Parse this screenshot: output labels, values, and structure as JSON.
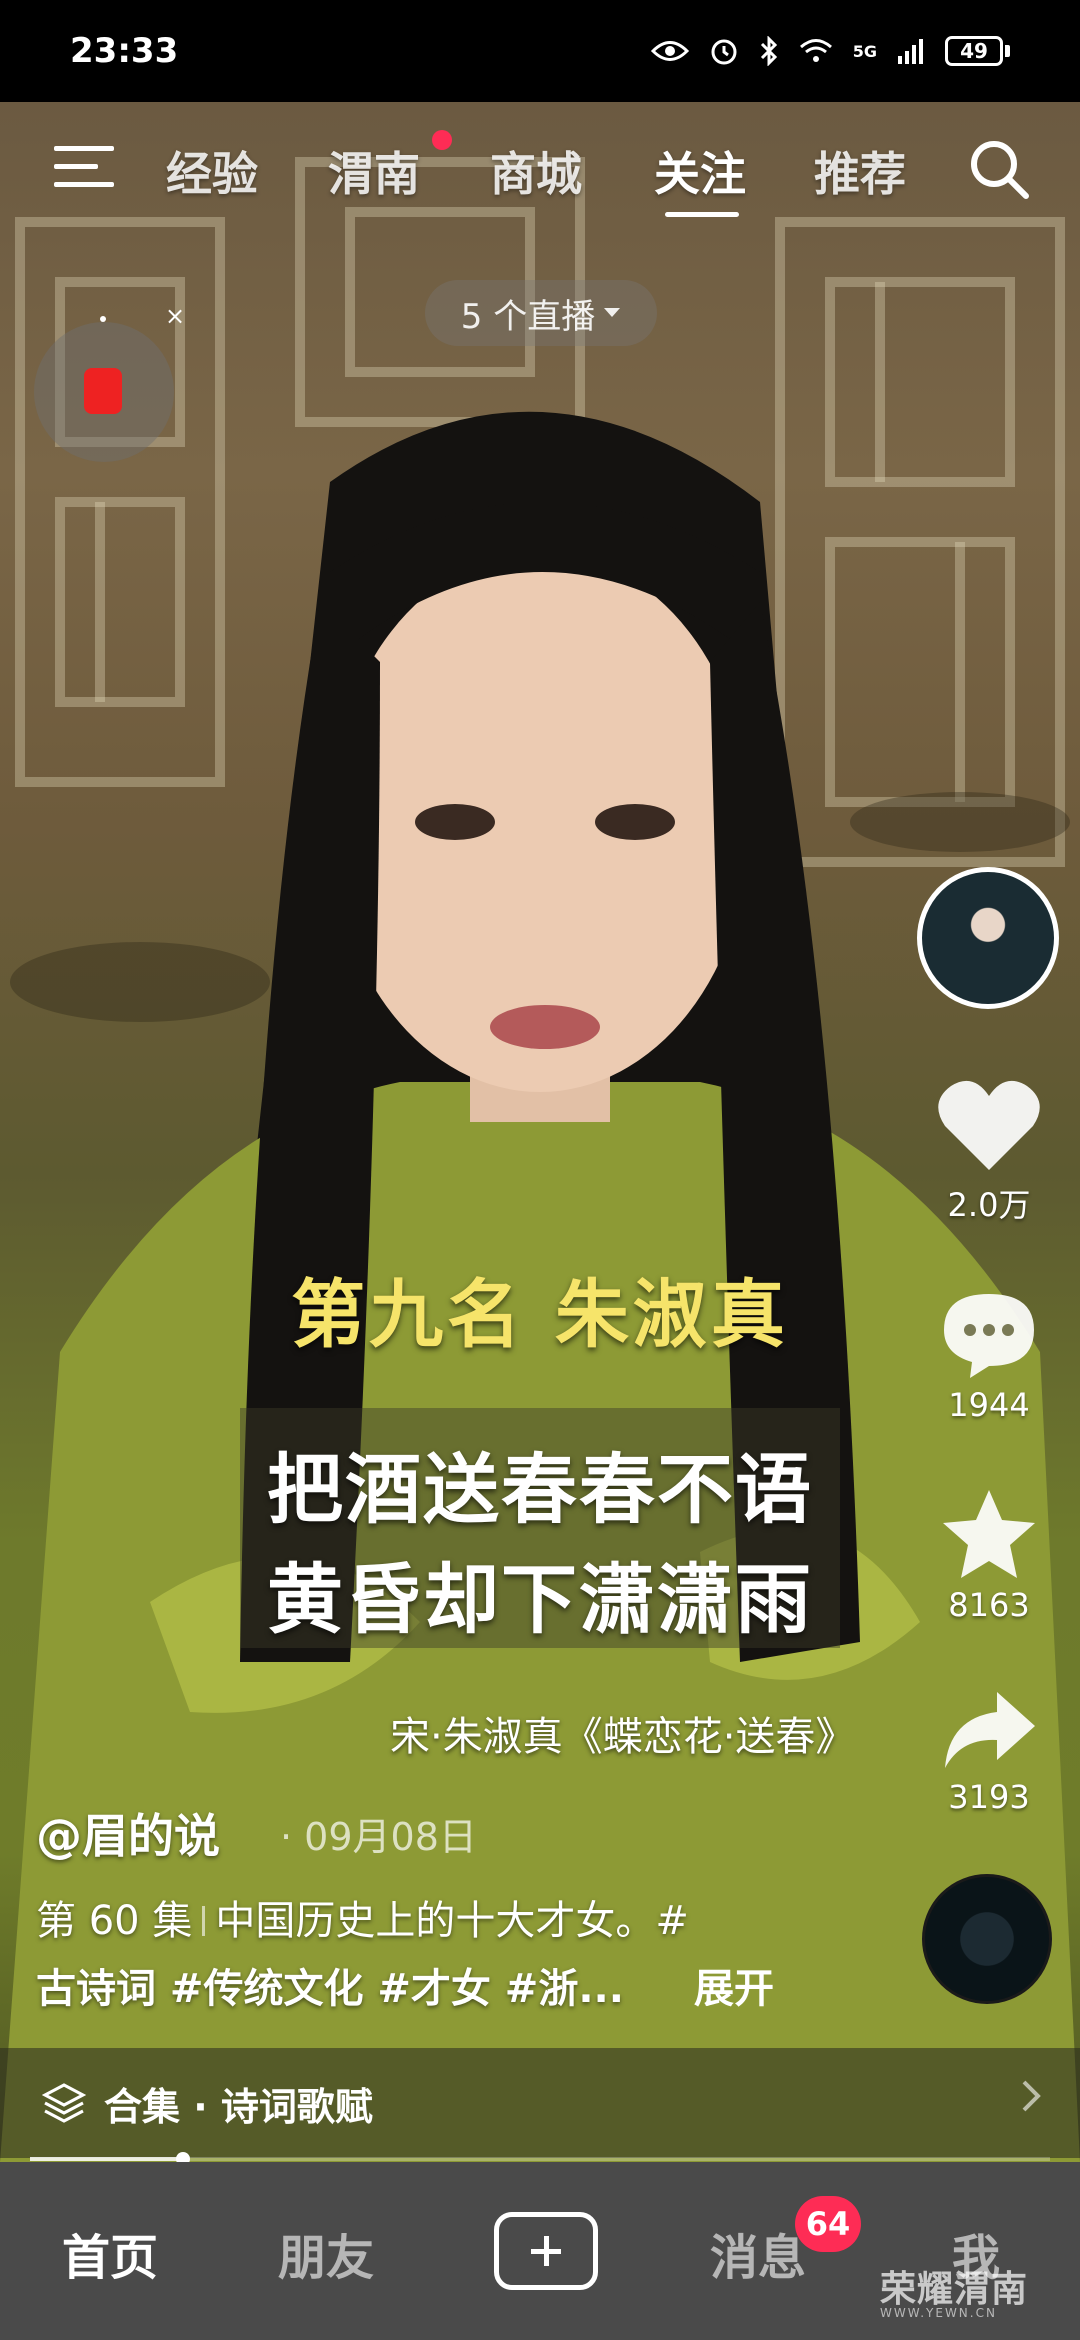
{
  "status_bar": {
    "time": "23:33",
    "network": "5G",
    "battery": "49"
  },
  "top_nav": {
    "tabs": [
      "经验",
      "渭南",
      "商城",
      "关注",
      "推荐"
    ],
    "active_tab": "关注"
  },
  "live": {
    "label": "5 个直播"
  },
  "captions": {
    "title": "第九名 朱淑真",
    "lines": [
      "把酒送春春不语",
      "黄昏却下潇潇雨"
    ],
    "source": "宋·朱淑真《蝶恋花·送春》"
  },
  "rail": {
    "likes": "2.0万",
    "comments": "1944",
    "favorites": "8163",
    "shares": "3193"
  },
  "post": {
    "author": "@眉的说",
    "date": "· 09月08日",
    "episode": "第 60 集",
    "desc": "中国历史上的十大才女。#",
    "tags": "古诗词 #传统文化 #才女 #浙...",
    "expand": "展开"
  },
  "collection": {
    "label": "合集 · 诗词歌赋"
  },
  "playback": {
    "progress": 0.15
  },
  "bottom_tabs": {
    "home": "首页",
    "friends": "朋友",
    "messages": "消息",
    "me": "我",
    "badge": "64"
  },
  "watermark": {
    "text": "荣耀渭南",
    "sub": "WWW.YEWN.CN"
  },
  "colors": {
    "accent": "#fe2c55",
    "caption_title": "#f6e46a"
  }
}
